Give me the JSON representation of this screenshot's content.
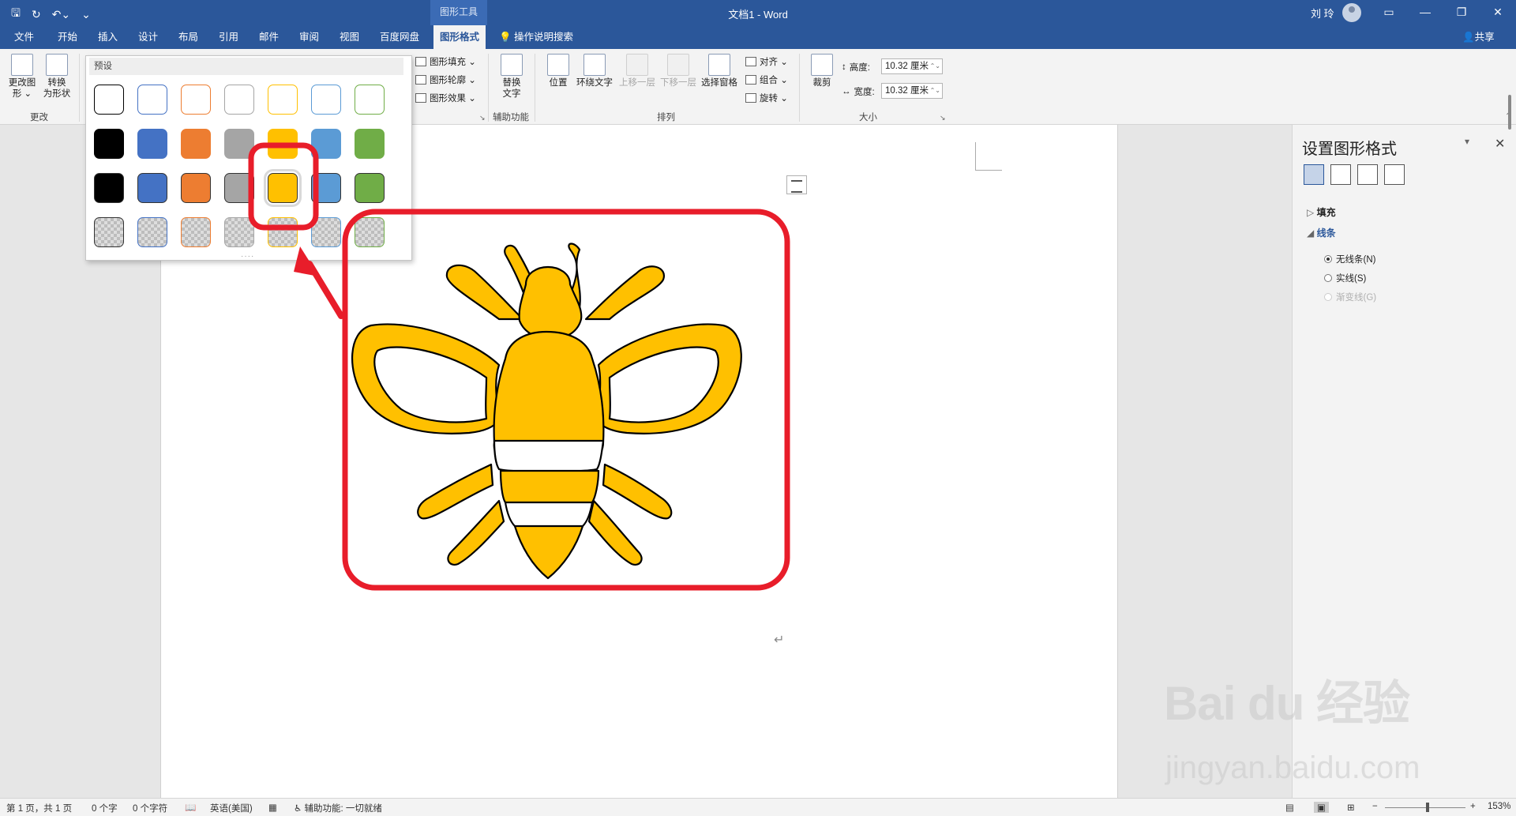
{
  "title_bar": {
    "context_tab_title": "图形工具",
    "document_title": "文档1  -  Word",
    "user_name": "刘 玲",
    "qat": {
      "save_icon": "save-icon",
      "autosave_icon": "refresh-icon",
      "undo_icon": "undo-icon",
      "customize_icon": "customize-icon"
    }
  },
  "tabs": [
    "文件",
    "开始",
    "插入",
    "设计",
    "布局",
    "引用",
    "邮件",
    "审阅",
    "视图",
    "百度网盘",
    "图形格式"
  ],
  "active_tab": "图形格式",
  "tell_me": "操作说明搜索",
  "share": "共享",
  "ribbon": {
    "change_group": {
      "edit_shape": "更改图\n形 ⌄",
      "convert": "转换\n为形状",
      "label": "更改"
    },
    "style_commands": {
      "fill": "图形填充 ⌄",
      "outline": "图形轮廓 ⌄",
      "effects": "图形效果 ⌄"
    },
    "accessibility": {
      "alt_text": "替换\n文字",
      "label": "辅助功能"
    },
    "arrange": {
      "position": "位置",
      "wrap": "环绕文字",
      "bring_forward": "上移一层",
      "send_backward": "下移一层",
      "selection_pane": "选择窗格",
      "align": "对齐 ⌄",
      "group": "组合 ⌄",
      "rotate": "旋转 ⌄",
      "label": "排列"
    },
    "size": {
      "crop": "裁剪",
      "height_label": "高度:",
      "height_value": "10.32 厘米",
      "width_label": "宽度:",
      "width_value": "10.32 厘米",
      "label": "大小"
    }
  },
  "gallery": {
    "header": "预设",
    "rows": [
      {
        "style": "outline",
        "colors": [
          "#000000",
          "#4472c4",
          "#ed7d31",
          "#a5a5a5",
          "#ffc000",
          "#5b9bd5",
          "#70ad47"
        ]
      },
      {
        "style": "filled",
        "colors": [
          "#000000",
          "#4472c4",
          "#ed7d31",
          "#a5a5a5",
          "#ffc000",
          "#5b9bd5",
          "#70ad47"
        ]
      },
      {
        "style": "filled-outlined",
        "colors": [
          "#000000",
          "#4472c4",
          "#ed7d31",
          "#a5a5a5",
          "#ffc000",
          "#5b9bd5",
          "#70ad47"
        ]
      },
      {
        "style": "transparent",
        "colors": [
          "#000000",
          "#4472c4",
          "#ed7d31",
          "#a5a5a5",
          "#ffc000",
          "#5b9bd5",
          "#70ad47"
        ]
      }
    ],
    "selected": {
      "row": 2,
      "col": 4
    },
    "grip": "····"
  },
  "shape": {
    "type": "bee",
    "fill": "#ffc000",
    "stroke": "#000000"
  },
  "annotations": {
    "color": "#e81d2a"
  },
  "format_pane": {
    "title": "设置图形格式",
    "tab_icons": [
      "fill-line-icon",
      "effects-icon",
      "layout-icon",
      "picture-icon"
    ],
    "sections": [
      {
        "label": "填充",
        "expanded": false
      },
      {
        "label": "线条",
        "expanded": true
      }
    ],
    "line_options": [
      {
        "label": "无线条(N)",
        "checked": true,
        "disabled": false
      },
      {
        "label": "实线(S)",
        "checked": false,
        "disabled": false
      },
      {
        "label": "渐变线(G)",
        "checked": false,
        "disabled": true
      }
    ]
  },
  "status_bar": {
    "page": "第 1 页，共 1 页",
    "words": "0 个字",
    "chars": "0 个字符",
    "language": "英语(美国)",
    "accessibility": "辅助功能: 一切就绪",
    "zoom": "153%"
  },
  "watermark": {
    "brand": "Bai du 经验",
    "url": "jingyan.baidu.com"
  }
}
